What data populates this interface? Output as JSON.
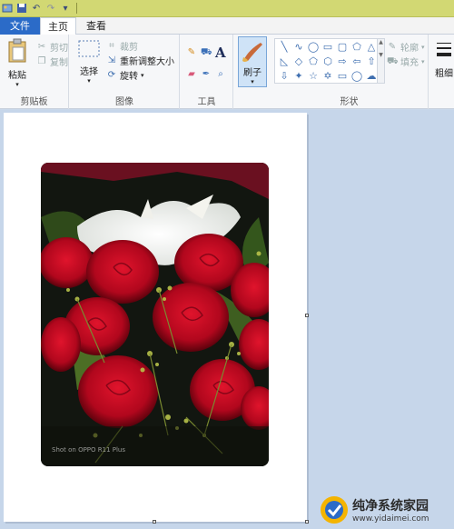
{
  "quick_access": {
    "icons": [
      "app-icon",
      "save-icon",
      "undo-icon",
      "redo-icon",
      "customize-icon"
    ]
  },
  "tabs": {
    "file": "文件",
    "home": "主页",
    "view": "查看"
  },
  "ribbon": {
    "clipboard": {
      "paste": "粘贴",
      "cut": "剪切",
      "copy": "复制",
      "label": "剪贴板"
    },
    "image": {
      "select": "选择",
      "crop": "裁剪",
      "resize": "重新调整大小",
      "rotate": "旋转",
      "label": "图像"
    },
    "tools": {
      "label": "工具",
      "text_glyph": "A"
    },
    "brushes": {
      "label": "刷子"
    },
    "shapes": {
      "label": "形状",
      "outline": "轮廓",
      "fill": "填充"
    },
    "size": {
      "label": "粗细"
    }
  },
  "canvas": {
    "photo_watermark": "Shot on OPPO R11 Plus"
  },
  "site_watermark": {
    "title": "纯净系统家园",
    "url": "www.yidaimei.com"
  }
}
